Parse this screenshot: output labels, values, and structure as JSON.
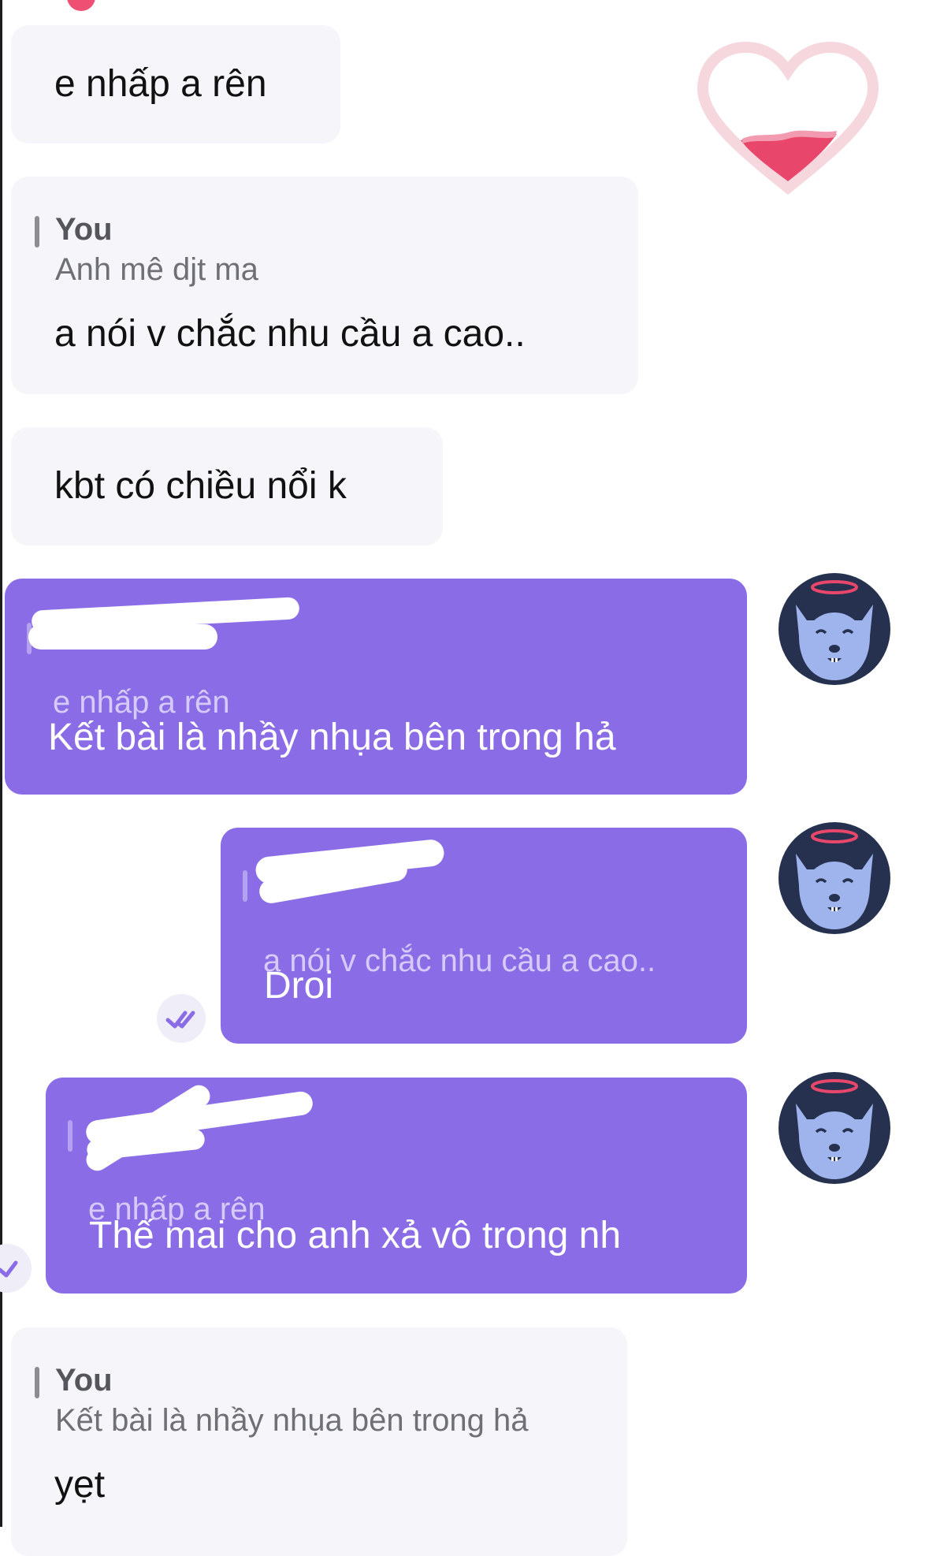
{
  "messages": [
    {
      "id": "m1",
      "direction": "incoming",
      "text": "e nhấp a rên"
    },
    {
      "id": "m2",
      "direction": "incoming",
      "reply": {
        "author": "You",
        "quote": "Anh mê djt ma"
      },
      "text": "a nói v chắc nhu cầu a cao.."
    },
    {
      "id": "m3",
      "direction": "incoming",
      "text": "kbt có chiều nổi k"
    },
    {
      "id": "m4",
      "direction": "outgoing",
      "reply": {
        "author": "",
        "quote": "e nhấp a rên"
      },
      "text": "Kết bài là nhầy nhụa bên trong hả"
    },
    {
      "id": "m5",
      "direction": "outgoing",
      "reply": {
        "author": "",
        "quote": "a nói v chắc nhu cầu a cao.."
      },
      "text": "Droi"
    },
    {
      "id": "m6",
      "direction": "outgoing",
      "reply": {
        "author": "",
        "quote": "e nhấp a rên"
      },
      "text": "Thế mai cho anh xả vô trong nh"
    },
    {
      "id": "m7",
      "direction": "incoming",
      "reply": {
        "author": "You",
        "quote": "Kết bài là nhầy nhụa bên trong hả"
      },
      "text": "yẹt"
    }
  ],
  "colors": {
    "outgoing_bubble": "#8a6de6",
    "incoming_bubble": "#f6f6fa",
    "avatar_bg": "#26314f",
    "avatar_face": "#9fb4ec",
    "heart_outline": "#f6d7de",
    "heart_fill": "#e8476b"
  },
  "icons": {
    "avatar": "dog-angel-avatar-icon",
    "read": "double-check-icon",
    "sticker": "heart-sticker-icon"
  }
}
